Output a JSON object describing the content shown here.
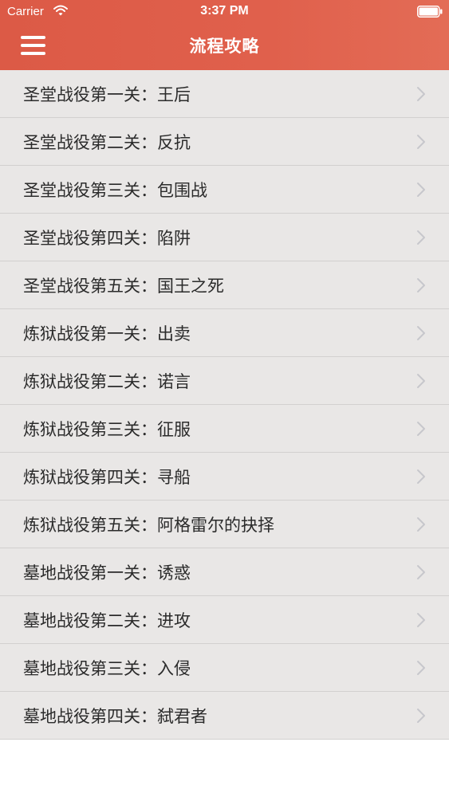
{
  "status_bar": {
    "carrier": "Carrier",
    "time": "3:37 PM"
  },
  "nav": {
    "title": "流程攻略",
    "menu_icon": "hamburger-menu-icon"
  },
  "colors": {
    "nav_bar": "#dc5a46",
    "list_background": "#e9e7e6",
    "separator": "#d2d0cf",
    "text": "#2b2b2b",
    "chevron": "#c7c7cc"
  },
  "list": {
    "items": [
      {
        "label": "圣堂战役第一关：王后"
      },
      {
        "label": "圣堂战役第二关：反抗"
      },
      {
        "label": "圣堂战役第三关：包围战"
      },
      {
        "label": "圣堂战役第四关：陷阱"
      },
      {
        "label": "圣堂战役第五关：国王之死"
      },
      {
        "label": "炼狱战役第一关：出卖"
      },
      {
        "label": "炼狱战役第二关：诺言"
      },
      {
        "label": "炼狱战役第三关：征服"
      },
      {
        "label": "炼狱战役第四关：寻船"
      },
      {
        "label": "炼狱战役第五关：阿格雷尔的抉择"
      },
      {
        "label": "墓地战役第一关：诱惑"
      },
      {
        "label": "墓地战役第二关：进攻"
      },
      {
        "label": "墓地战役第三关：入侵"
      },
      {
        "label": "墓地战役第四关：弑君者"
      }
    ]
  }
}
